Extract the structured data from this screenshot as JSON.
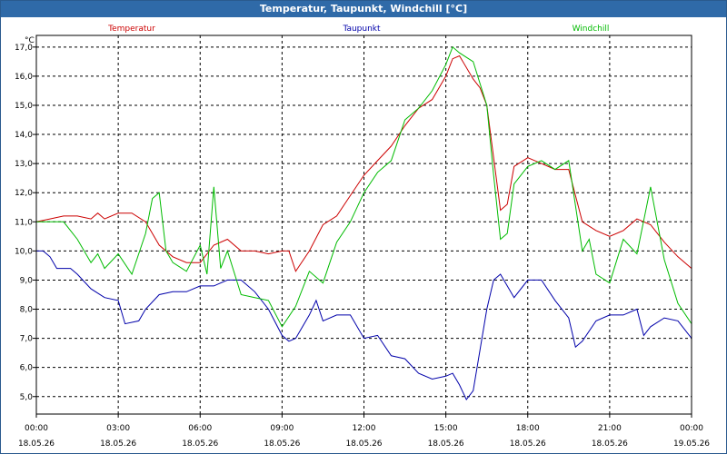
{
  "window": {
    "title": "Temperatur, Taupunkt, Windchill [°C]"
  },
  "colors": {
    "temperatur": "#cc0000",
    "taupunkt": "#0000aa",
    "windchill": "#00bb00",
    "grid": "#000000",
    "titlebar": "#2f6aa8"
  },
  "chart_data": {
    "type": "line",
    "title": "Temperatur, Taupunkt, Windchill [°C]",
    "ylabel": "°C",
    "xlabel": "",
    "ylim": [
      4.4,
      17.4
    ],
    "xlim": [
      0,
      24
    ],
    "grid": true,
    "legend_position": "top",
    "y_ticks": [
      5.0,
      6.0,
      7.0,
      8.0,
      9.0,
      10.0,
      11.0,
      12.0,
      13.0,
      14.0,
      15.0,
      16.0,
      17.0
    ],
    "y_tick_labels": [
      "5,0",
      "6,0",
      "7,0",
      "8,0",
      "9,0",
      "10,0",
      "11,0",
      "12,0",
      "13,0",
      "14,0",
      "15,0",
      "16,0",
      "17,0"
    ],
    "x_ticks": [
      {
        "time": "00:00",
        "date": "18.05.26"
      },
      {
        "time": "03:00",
        "date": "18.05.26"
      },
      {
        "time": "06:00",
        "date": "18.05.26"
      },
      {
        "time": "09:00",
        "date": "18.05.26"
      },
      {
        "time": "12:00",
        "date": "18.05.26"
      },
      {
        "time": "15:00",
        "date": "18.05.26"
      },
      {
        "time": "18:00",
        "date": "18.05.26"
      },
      {
        "time": "21:00",
        "date": "18.05.26"
      },
      {
        "time": "00:00",
        "date": "19.05.26"
      }
    ],
    "series": [
      {
        "name": "Temperatur",
        "points": [
          [
            "00:00",
            11.0
          ],
          [
            "00:30",
            11.1
          ],
          [
            "01:00",
            11.2
          ],
          [
            "01:30",
            11.2
          ],
          [
            "02:00",
            11.1
          ],
          [
            "02:15",
            11.3
          ],
          [
            "02:30",
            11.1
          ],
          [
            "03:00",
            11.3
          ],
          [
            "03:30",
            11.3
          ],
          [
            "04:00",
            11.0
          ],
          [
            "04:30",
            10.2
          ],
          [
            "05:00",
            9.8
          ],
          [
            "05:30",
            9.6
          ],
          [
            "06:00",
            9.6
          ],
          [
            "06:30",
            10.2
          ],
          [
            "07:00",
            10.4
          ],
          [
            "07:30",
            10.0
          ],
          [
            "08:00",
            10.0
          ],
          [
            "08:30",
            9.9
          ],
          [
            "09:00",
            10.0
          ],
          [
            "09:15",
            10.0
          ],
          [
            "09:30",
            9.3
          ],
          [
            "10:00",
            10.0
          ],
          [
            "10:30",
            10.9
          ],
          [
            "11:00",
            11.2
          ],
          [
            "11:30",
            11.9
          ],
          [
            "12:00",
            12.6
          ],
          [
            "12:30",
            13.1
          ],
          [
            "13:00",
            13.6
          ],
          [
            "13:30",
            14.3
          ],
          [
            "14:00",
            14.9
          ],
          [
            "14:30",
            15.2
          ],
          [
            "15:00",
            16.0
          ],
          [
            "15:15",
            16.6
          ],
          [
            "15:30",
            16.7
          ],
          [
            "16:00",
            15.9
          ],
          [
            "16:15",
            15.6
          ],
          [
            "16:30",
            15.0
          ],
          [
            "16:45",
            13.2
          ],
          [
            "17:00",
            11.4
          ],
          [
            "17:15",
            11.6
          ],
          [
            "17:30",
            12.9
          ],
          [
            "18:00",
            13.2
          ],
          [
            "18:30",
            13.0
          ],
          [
            "19:00",
            12.8
          ],
          [
            "19:30",
            12.8
          ],
          [
            "20:00",
            11.0
          ],
          [
            "20:30",
            10.7
          ],
          [
            "21:00",
            10.5
          ],
          [
            "21:30",
            10.7
          ],
          [
            "22:00",
            11.1
          ],
          [
            "22:30",
            10.9
          ],
          [
            "23:00",
            10.3
          ],
          [
            "23:30",
            9.8
          ],
          [
            "24:00",
            9.4
          ]
        ]
      },
      {
        "name": "Taupunkt",
        "points": [
          [
            "00:00",
            10.0
          ],
          [
            "00:15",
            10.0
          ],
          [
            "00:30",
            9.8
          ],
          [
            "00:45",
            9.4
          ],
          [
            "01:15",
            9.4
          ],
          [
            "01:30",
            9.2
          ],
          [
            "02:00",
            8.7
          ],
          [
            "02:30",
            8.4
          ],
          [
            "03:00",
            8.3
          ],
          [
            "03:15",
            7.5
          ],
          [
            "03:45",
            7.6
          ],
          [
            "04:00",
            8.0
          ],
          [
            "04:30",
            8.5
          ],
          [
            "05:00",
            8.6
          ],
          [
            "05:30",
            8.6
          ],
          [
            "06:00",
            8.8
          ],
          [
            "06:30",
            8.8
          ],
          [
            "07:00",
            9.0
          ],
          [
            "07:30",
            9.0
          ],
          [
            "08:00",
            8.6
          ],
          [
            "08:30",
            8.0
          ],
          [
            "09:00",
            7.1
          ],
          [
            "09:15",
            6.9
          ],
          [
            "09:30",
            7.0
          ],
          [
            "10:00",
            7.8
          ],
          [
            "10:15",
            8.3
          ],
          [
            "10:30",
            7.6
          ],
          [
            "11:00",
            7.8
          ],
          [
            "11:30",
            7.8
          ],
          [
            "12:00",
            7.0
          ],
          [
            "12:30",
            7.1
          ],
          [
            "13:00",
            6.4
          ],
          [
            "13:30",
            6.3
          ],
          [
            "14:00",
            5.8
          ],
          [
            "14:30",
            5.6
          ],
          [
            "15:00",
            5.7
          ],
          [
            "15:15",
            5.8
          ],
          [
            "15:30",
            5.4
          ],
          [
            "15:45",
            4.9
          ],
          [
            "16:00",
            5.2
          ],
          [
            "16:30",
            8.0
          ],
          [
            "16:45",
            9.0
          ],
          [
            "17:00",
            9.2
          ],
          [
            "17:30",
            8.4
          ],
          [
            "18:00",
            9.0
          ],
          [
            "18:30",
            9.0
          ],
          [
            "19:00",
            8.3
          ],
          [
            "19:30",
            7.7
          ],
          [
            "19:45",
            6.7
          ],
          [
            "20:00",
            6.9
          ],
          [
            "20:30",
            7.6
          ],
          [
            "21:00",
            7.8
          ],
          [
            "21:30",
            7.8
          ],
          [
            "22:00",
            8.0
          ],
          [
            "22:15",
            7.1
          ],
          [
            "22:30",
            7.4
          ],
          [
            "23:00",
            7.7
          ],
          [
            "23:30",
            7.6
          ],
          [
            "24:00",
            7.0
          ]
        ]
      },
      {
        "name": "Windchill",
        "points": [
          [
            "00:00",
            11.0
          ],
          [
            "00:30",
            11.0
          ],
          [
            "01:00",
            11.0
          ],
          [
            "01:30",
            10.4
          ],
          [
            "02:00",
            9.6
          ],
          [
            "02:15",
            9.9
          ],
          [
            "02:30",
            9.4
          ],
          [
            "03:00",
            9.9
          ],
          [
            "03:30",
            9.2
          ],
          [
            "04:00",
            10.6
          ],
          [
            "04:15",
            11.8
          ],
          [
            "04:30",
            12.0
          ],
          [
            "04:45",
            10.0
          ],
          [
            "05:00",
            9.6
          ],
          [
            "05:30",
            9.3
          ],
          [
            "06:00",
            10.2
          ],
          [
            "06:15",
            9.2
          ],
          [
            "06:30",
            12.2
          ],
          [
            "06:45",
            9.4
          ],
          [
            "07:00",
            10.0
          ],
          [
            "07:30",
            8.5
          ],
          [
            "08:00",
            8.4
          ],
          [
            "08:30",
            8.3
          ],
          [
            "09:00",
            7.4
          ],
          [
            "09:30",
            8.1
          ],
          [
            "10:00",
            9.3
          ],
          [
            "10:30",
            8.9
          ],
          [
            "11:00",
            10.3
          ],
          [
            "11:30",
            11.0
          ],
          [
            "12:00",
            12.0
          ],
          [
            "12:30",
            12.7
          ],
          [
            "13:00",
            13.1
          ],
          [
            "13:30",
            14.5
          ],
          [
            "14:00",
            14.9
          ],
          [
            "14:30",
            15.5
          ],
          [
            "15:00",
            16.4
          ],
          [
            "15:15",
            17.0
          ],
          [
            "15:30",
            16.8
          ],
          [
            "16:00",
            16.5
          ],
          [
            "16:30",
            15.0
          ],
          [
            "16:45",
            12.6
          ],
          [
            "17:00",
            10.4
          ],
          [
            "17:15",
            10.6
          ],
          [
            "17:30",
            12.3
          ],
          [
            "18:00",
            12.9
          ],
          [
            "18:30",
            13.1
          ],
          [
            "19:00",
            12.8
          ],
          [
            "19:30",
            13.1
          ],
          [
            "20:00",
            10.0
          ],
          [
            "20:15",
            10.4
          ],
          [
            "20:30",
            9.2
          ],
          [
            "21:00",
            8.9
          ],
          [
            "21:30",
            10.4
          ],
          [
            "22:00",
            9.9
          ],
          [
            "22:30",
            12.2
          ],
          [
            "23:00",
            9.7
          ],
          [
            "23:30",
            8.2
          ],
          [
            "24:00",
            7.5
          ]
        ]
      }
    ]
  }
}
